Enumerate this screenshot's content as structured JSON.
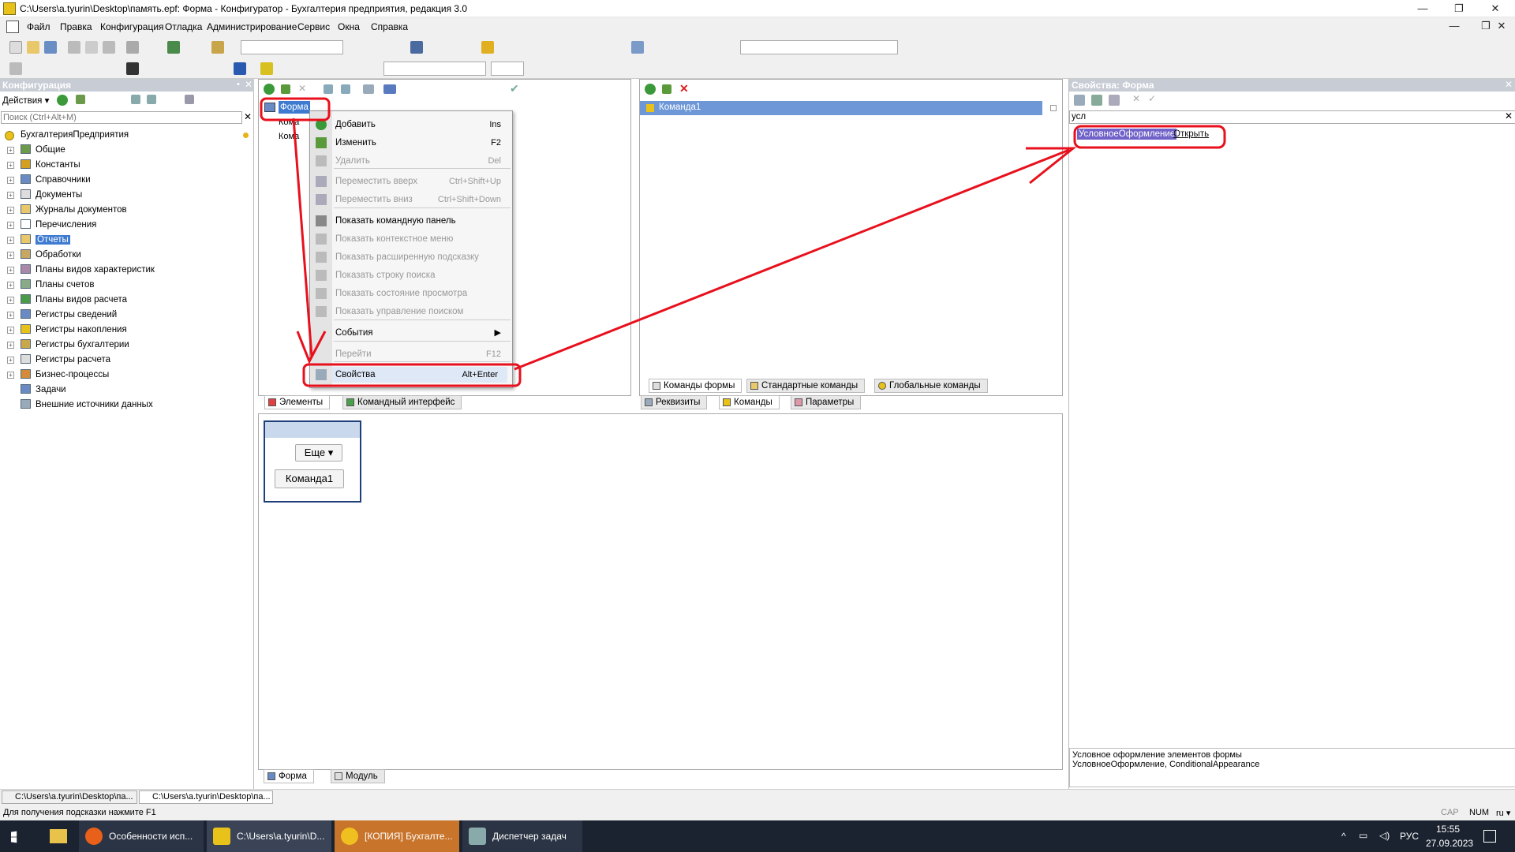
{
  "window": {
    "title": "C:\\Users\\a.tyurin\\Desktop\\память.epf: Форма - Конфигуратор - Бухгалтерия предприятия, редакция 3.0",
    "min": "—",
    "max": "❐",
    "close": "✕"
  },
  "menu": [
    "Файл",
    "Правка",
    "Конфигурация",
    "Отладка",
    "Администрирование",
    "Сервис",
    "Окна",
    "Справка"
  ],
  "left": {
    "header": "Конфигурация",
    "actions_label": "Действия ▾",
    "search_placeholder": "Поиск (Ctrl+Alt+M)",
    "root": "БухгалтерияПредприятия",
    "items": [
      "Общие",
      "Константы",
      "Справочники",
      "Документы",
      "Журналы документов",
      "Перечисления",
      "Отчеты",
      "Обработки",
      "Планы видов характеристик",
      "Планы счетов",
      "Планы видов расчета",
      "Регистры сведений",
      "Регистры накопления",
      "Регистры бухгалтерии",
      "Регистры расчета",
      "Бизнес-процессы",
      "Задачи",
      "Внешние источники данных"
    ],
    "selected_index": 6
  },
  "elements": {
    "root": "Форма",
    "child1": "Кома",
    "child2": "Кома"
  },
  "context_menu": [
    {
      "label": "Добавить",
      "shortcut": "Ins",
      "disabled": false
    },
    {
      "label": "Изменить",
      "shortcut": "F2",
      "disabled": false
    },
    {
      "label": "Удалить",
      "shortcut": "Del",
      "disabled": true
    },
    {
      "label": "Переместить вверх",
      "shortcut": "Ctrl+Shift+Up",
      "disabled": true
    },
    {
      "label": "Переместить вниз",
      "shortcut": "Ctrl+Shift+Down",
      "disabled": true
    },
    {
      "label": "Показать командную панель",
      "shortcut": "",
      "disabled": false
    },
    {
      "label": "Показать контекстное меню",
      "shortcut": "",
      "disabled": true
    },
    {
      "label": "Показать расширенную подсказку",
      "shortcut": "",
      "disabled": true
    },
    {
      "label": "Показать строку поиска",
      "shortcut": "",
      "disabled": true
    },
    {
      "label": "Показать состояние просмотра",
      "shortcut": "",
      "disabled": true
    },
    {
      "label": "Показать управление поиском",
      "shortcut": "",
      "disabled": true
    },
    {
      "label": "События",
      "shortcut": "▶",
      "disabled": false
    },
    {
      "label": "Перейти",
      "shortcut": "F12",
      "disabled": true
    },
    {
      "label": "Свойства",
      "shortcut": "Alt+Enter",
      "disabled": false
    }
  ],
  "commands": {
    "item": "Команда1"
  },
  "tabs": {
    "left_bottom": [
      "Элементы",
      "Командный интерфейс"
    ],
    "right_top": [
      "Команды формы",
      "Стандартные команды",
      "Глобальные команды"
    ],
    "right_bottom": [
      "Реквизиты",
      "Команды",
      "Параметры"
    ],
    "form_bottom": [
      "Форма",
      "Модуль"
    ]
  },
  "preview": {
    "more_button": "Еще ▾",
    "command_button": "Команда1"
  },
  "properties": {
    "header": "Свойства: Форма",
    "search_value": "усл",
    "prop_name": "УсловноеОформление",
    "prop_value": "Открыть",
    "desc1": "Условное оформление элементов формы",
    "desc2": "УсловноеОформление, ConditionalAppearance"
  },
  "windows_bar": [
    "C:\\Users\\a.tyurin\\Desktop\\па...",
    "C:\\Users\\a.tyurin\\Desktop\\па..."
  ],
  "status": {
    "hint": "Для получения подсказки нажмите F1",
    "cap": "CAP",
    "num": "NUM",
    "lang": "ru ▾"
  },
  "taskbar": {
    "items": [
      "Особенности исп...",
      "C:\\Users\\a.tyurin\\D...",
      "[КОПИЯ] Бухгалте...",
      "Диспетчер задач"
    ],
    "lang": "РУС",
    "time": "15:55",
    "date": "27.09.2023"
  },
  "colors": {
    "selection": "#3e7bd0",
    "annotation": "#e8101c",
    "header_bg": "#c7ccd5"
  }
}
